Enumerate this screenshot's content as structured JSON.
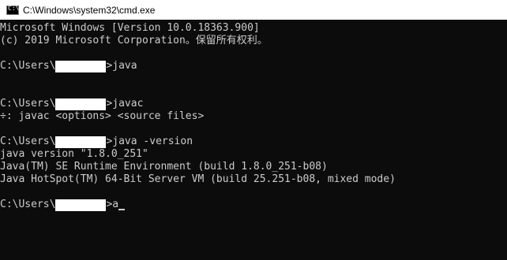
{
  "window": {
    "title": "C:\\Windows\\system32\\cmd.exe",
    "icon": "cmd-console-icon"
  },
  "console": {
    "banner_line1": "Microsoft Windows [Version 10.0.18363.900]",
    "banner_line2": "(c) 2019 Microsoft Corporation。保留所有权利。",
    "prompt_prefix": "C:\\Users\\",
    "prompt_suffix": ">",
    "cmd1": "java",
    "cmd2": "javac",
    "cmd2_output": "÷: javac <options> <source files>",
    "cmd3": "java -version",
    "cmd3_output": [
      "java version \"1.8.0_251\"",
      "Java(TM) SE Runtime Environment (build 1.8.0_251-b08)",
      "Java HotSpot(TM) 64-Bit Server VM (build 25.251-b08, mixed mode)"
    ],
    "current_input": "a"
  }
}
